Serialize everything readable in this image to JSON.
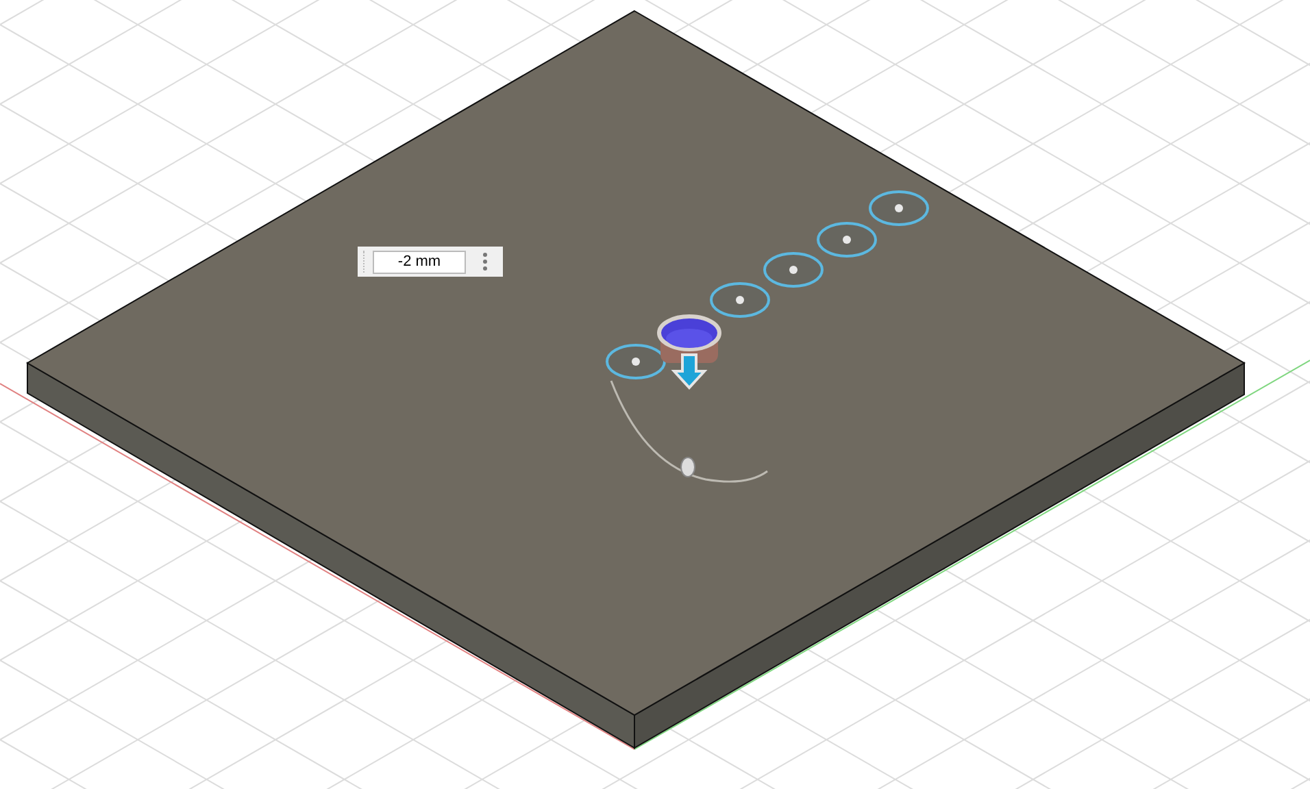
{
  "dimension_input": {
    "value": "-2 mm"
  }
}
